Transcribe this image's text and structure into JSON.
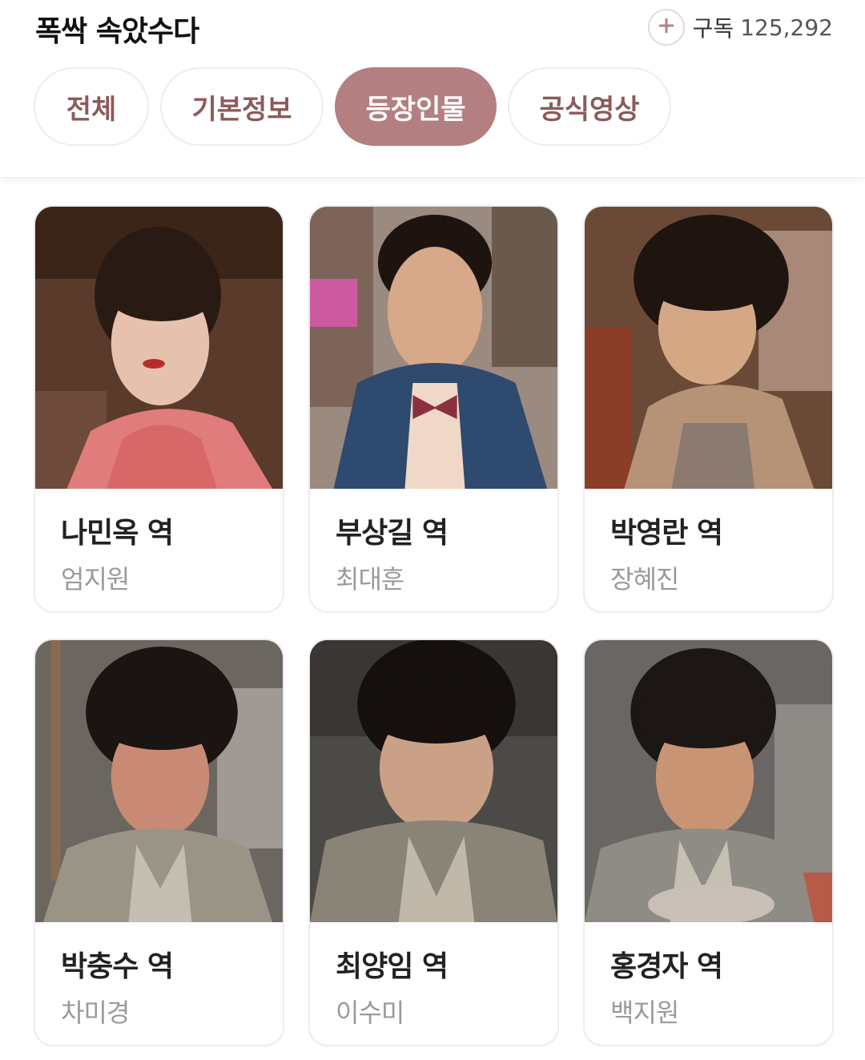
{
  "header": {
    "title": "폭싹 속았수다",
    "subscribe_label": "구독",
    "subscriber_count": "125,292",
    "plus_icon": "plus-icon",
    "accent_color": "#b47f80"
  },
  "tabs": [
    {
      "label": "전체",
      "active": false
    },
    {
      "label": "기본정보",
      "active": false
    },
    {
      "label": "등장인물",
      "active": true
    },
    {
      "label": "공식영상",
      "active": false
    }
  ],
  "characters": [
    {
      "role": "나민옥 역",
      "actor": "엄지원"
    },
    {
      "role": "부상길 역",
      "actor": "최대훈"
    },
    {
      "role": "박영란 역",
      "actor": "장혜진"
    },
    {
      "role": "박충수 역",
      "actor": "차미경"
    },
    {
      "role": "최양임 역",
      "actor": "이수미"
    },
    {
      "role": "홍경자 역",
      "actor": "백지원"
    }
  ]
}
